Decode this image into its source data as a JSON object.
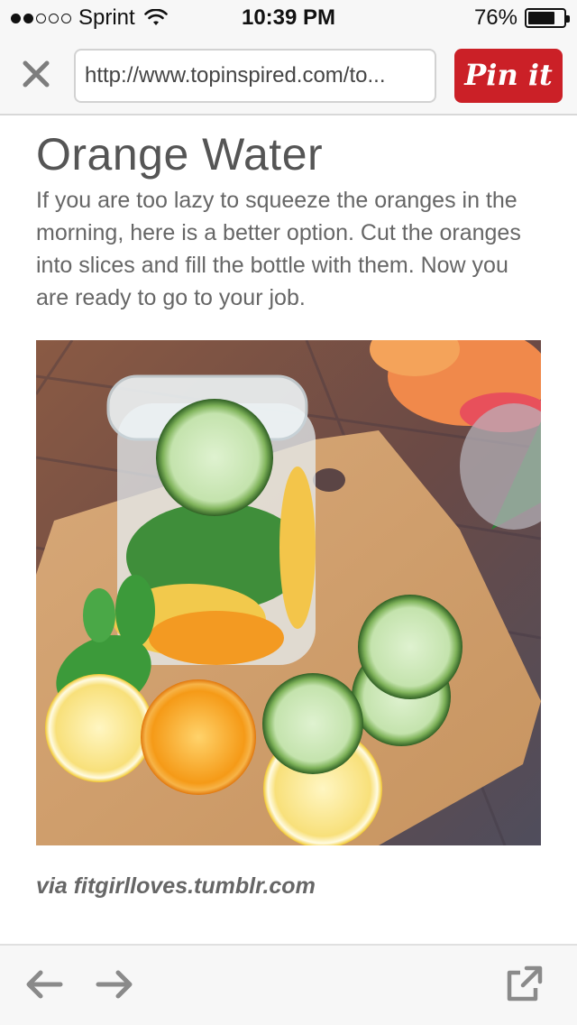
{
  "status_bar": {
    "carrier": "Sprint",
    "signal_bars": 2,
    "signal_total": 5,
    "time": "10:39 PM",
    "battery": "76%",
    "battery_level": 0.76
  },
  "browser": {
    "url": "http://www.topinspired.com/to...",
    "pin_label": "Pin it",
    "pin_color": "#cb2027"
  },
  "article": {
    "title": "Orange Water",
    "body": "If you are too lazy to squeeze the oranges in the morning, here is a better option. Cut the oranges into slices and fill the bottle with them. Now you are ready to go to your job.",
    "credit": "via fitgirlloves.tumblr.com"
  },
  "icons": {
    "close": "close-icon",
    "wifi": "wifi-icon",
    "back": "back-arrow-icon",
    "forward": "forward-arrow-icon",
    "share": "external-share-icon"
  }
}
